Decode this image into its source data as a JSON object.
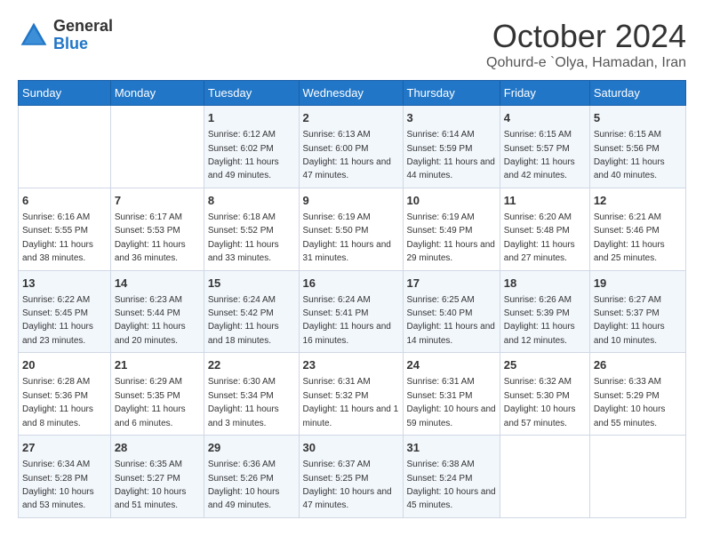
{
  "header": {
    "logo_general": "General",
    "logo_blue": "Blue",
    "month_title": "October 2024",
    "location": "Qohurd-e `Olya, Hamadan, Iran"
  },
  "days_of_week": [
    "Sunday",
    "Monday",
    "Tuesday",
    "Wednesday",
    "Thursday",
    "Friday",
    "Saturday"
  ],
  "weeks": [
    [
      {
        "day": "",
        "sunrise": "",
        "sunset": "",
        "daylight": ""
      },
      {
        "day": "",
        "sunrise": "",
        "sunset": "",
        "daylight": ""
      },
      {
        "day": "1",
        "sunrise": "Sunrise: 6:12 AM",
        "sunset": "Sunset: 6:02 PM",
        "daylight": "Daylight: 11 hours and 49 minutes."
      },
      {
        "day": "2",
        "sunrise": "Sunrise: 6:13 AM",
        "sunset": "Sunset: 6:00 PM",
        "daylight": "Daylight: 11 hours and 47 minutes."
      },
      {
        "day": "3",
        "sunrise": "Sunrise: 6:14 AM",
        "sunset": "Sunset: 5:59 PM",
        "daylight": "Daylight: 11 hours and 44 minutes."
      },
      {
        "day": "4",
        "sunrise": "Sunrise: 6:15 AM",
        "sunset": "Sunset: 5:57 PM",
        "daylight": "Daylight: 11 hours and 42 minutes."
      },
      {
        "day": "5",
        "sunrise": "Sunrise: 6:15 AM",
        "sunset": "Sunset: 5:56 PM",
        "daylight": "Daylight: 11 hours and 40 minutes."
      }
    ],
    [
      {
        "day": "6",
        "sunrise": "Sunrise: 6:16 AM",
        "sunset": "Sunset: 5:55 PM",
        "daylight": "Daylight: 11 hours and 38 minutes."
      },
      {
        "day": "7",
        "sunrise": "Sunrise: 6:17 AM",
        "sunset": "Sunset: 5:53 PM",
        "daylight": "Daylight: 11 hours and 36 minutes."
      },
      {
        "day": "8",
        "sunrise": "Sunrise: 6:18 AM",
        "sunset": "Sunset: 5:52 PM",
        "daylight": "Daylight: 11 hours and 33 minutes."
      },
      {
        "day": "9",
        "sunrise": "Sunrise: 6:19 AM",
        "sunset": "Sunset: 5:50 PM",
        "daylight": "Daylight: 11 hours and 31 minutes."
      },
      {
        "day": "10",
        "sunrise": "Sunrise: 6:19 AM",
        "sunset": "Sunset: 5:49 PM",
        "daylight": "Daylight: 11 hours and 29 minutes."
      },
      {
        "day": "11",
        "sunrise": "Sunrise: 6:20 AM",
        "sunset": "Sunset: 5:48 PM",
        "daylight": "Daylight: 11 hours and 27 minutes."
      },
      {
        "day": "12",
        "sunrise": "Sunrise: 6:21 AM",
        "sunset": "Sunset: 5:46 PM",
        "daylight": "Daylight: 11 hours and 25 minutes."
      }
    ],
    [
      {
        "day": "13",
        "sunrise": "Sunrise: 6:22 AM",
        "sunset": "Sunset: 5:45 PM",
        "daylight": "Daylight: 11 hours and 23 minutes."
      },
      {
        "day": "14",
        "sunrise": "Sunrise: 6:23 AM",
        "sunset": "Sunset: 5:44 PM",
        "daylight": "Daylight: 11 hours and 20 minutes."
      },
      {
        "day": "15",
        "sunrise": "Sunrise: 6:24 AM",
        "sunset": "Sunset: 5:42 PM",
        "daylight": "Daylight: 11 hours and 18 minutes."
      },
      {
        "day": "16",
        "sunrise": "Sunrise: 6:24 AM",
        "sunset": "Sunset: 5:41 PM",
        "daylight": "Daylight: 11 hours and 16 minutes."
      },
      {
        "day": "17",
        "sunrise": "Sunrise: 6:25 AM",
        "sunset": "Sunset: 5:40 PM",
        "daylight": "Daylight: 11 hours and 14 minutes."
      },
      {
        "day": "18",
        "sunrise": "Sunrise: 6:26 AM",
        "sunset": "Sunset: 5:39 PM",
        "daylight": "Daylight: 11 hours and 12 minutes."
      },
      {
        "day": "19",
        "sunrise": "Sunrise: 6:27 AM",
        "sunset": "Sunset: 5:37 PM",
        "daylight": "Daylight: 11 hours and 10 minutes."
      }
    ],
    [
      {
        "day": "20",
        "sunrise": "Sunrise: 6:28 AM",
        "sunset": "Sunset: 5:36 PM",
        "daylight": "Daylight: 11 hours and 8 minutes."
      },
      {
        "day": "21",
        "sunrise": "Sunrise: 6:29 AM",
        "sunset": "Sunset: 5:35 PM",
        "daylight": "Daylight: 11 hours and 6 minutes."
      },
      {
        "day": "22",
        "sunrise": "Sunrise: 6:30 AM",
        "sunset": "Sunset: 5:34 PM",
        "daylight": "Daylight: 11 hours and 3 minutes."
      },
      {
        "day": "23",
        "sunrise": "Sunrise: 6:31 AM",
        "sunset": "Sunset: 5:32 PM",
        "daylight": "Daylight: 11 hours and 1 minute."
      },
      {
        "day": "24",
        "sunrise": "Sunrise: 6:31 AM",
        "sunset": "Sunset: 5:31 PM",
        "daylight": "Daylight: 10 hours and 59 minutes."
      },
      {
        "day": "25",
        "sunrise": "Sunrise: 6:32 AM",
        "sunset": "Sunset: 5:30 PM",
        "daylight": "Daylight: 10 hours and 57 minutes."
      },
      {
        "day": "26",
        "sunrise": "Sunrise: 6:33 AM",
        "sunset": "Sunset: 5:29 PM",
        "daylight": "Daylight: 10 hours and 55 minutes."
      }
    ],
    [
      {
        "day": "27",
        "sunrise": "Sunrise: 6:34 AM",
        "sunset": "Sunset: 5:28 PM",
        "daylight": "Daylight: 10 hours and 53 minutes."
      },
      {
        "day": "28",
        "sunrise": "Sunrise: 6:35 AM",
        "sunset": "Sunset: 5:27 PM",
        "daylight": "Daylight: 10 hours and 51 minutes."
      },
      {
        "day": "29",
        "sunrise": "Sunrise: 6:36 AM",
        "sunset": "Sunset: 5:26 PM",
        "daylight": "Daylight: 10 hours and 49 minutes."
      },
      {
        "day": "30",
        "sunrise": "Sunrise: 6:37 AM",
        "sunset": "Sunset: 5:25 PM",
        "daylight": "Daylight: 10 hours and 47 minutes."
      },
      {
        "day": "31",
        "sunrise": "Sunrise: 6:38 AM",
        "sunset": "Sunset: 5:24 PM",
        "daylight": "Daylight: 10 hours and 45 minutes."
      },
      {
        "day": "",
        "sunrise": "",
        "sunset": "",
        "daylight": ""
      },
      {
        "day": "",
        "sunrise": "",
        "sunset": "",
        "daylight": ""
      }
    ]
  ]
}
